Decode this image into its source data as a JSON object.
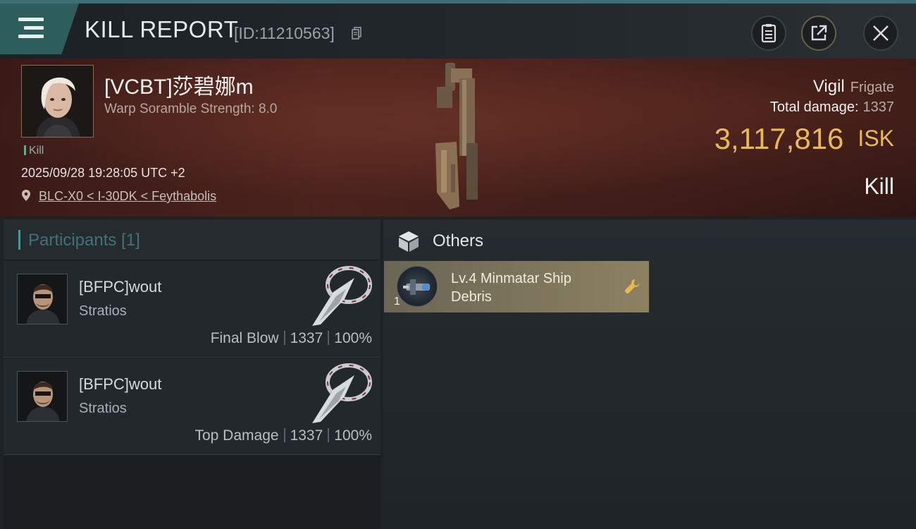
{
  "header": {
    "title": "KILL REPORT",
    "report_id": "[ID:11210563]"
  },
  "victim": {
    "name": "[VCBT]莎碧娜m",
    "scramble": "Warp Soramble Strength: 8.0",
    "tag": "Kill",
    "datetime": "2025/09/28 19:28:05 UTC +2",
    "location": "BLC-X0 < I-30DK < Feythabolis",
    "ship": "Vigil",
    "ship_class": "Frigate",
    "total_damage_label": "Total damage:",
    "total_damage": "1337",
    "isk_value": "3,117,816",
    "isk_unit": "ISK",
    "result": "Kill"
  },
  "participants": {
    "label": "Participants [1]",
    "rows": [
      {
        "name": "[BFPC]wout",
        "ship": "Stratios",
        "role": "Final Blow",
        "damage": "1337",
        "percent": "100%"
      },
      {
        "name": "[BFPC]wout",
        "ship": "Stratios",
        "role": "Top Damage",
        "damage": "1337",
        "percent": "100%"
      }
    ]
  },
  "others": {
    "label": "Others",
    "items": [
      {
        "name": "Lv.4 Minmatar Ship Debris",
        "qty": "1"
      }
    ]
  },
  "colors": {
    "accent_teal": "#2e5d5d",
    "isk_gold": "#e9b85a",
    "item_card": "#8c8262",
    "banner_red": "#4b221d"
  },
  "icons": [
    "menu-icon",
    "copy-icon",
    "clipboard-icon",
    "share-icon",
    "close-icon",
    "location-pin-icon",
    "box-icon",
    "wrench-icon"
  ]
}
